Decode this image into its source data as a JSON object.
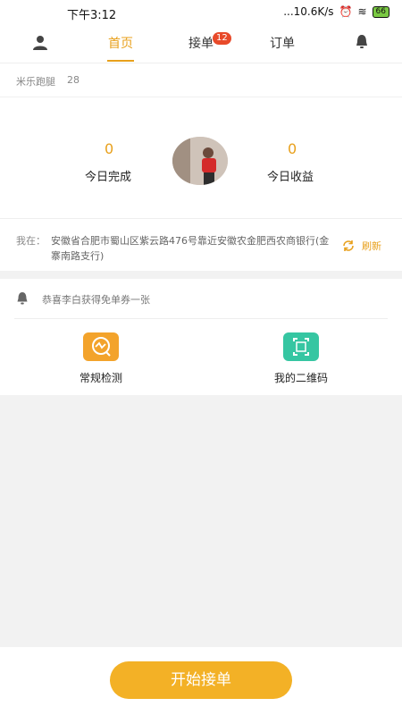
{
  "status": {
    "time": "下午3:12",
    "network": "...10.6K/s",
    "battery": "66"
  },
  "nav": {
    "tabs": [
      "首页",
      "接单",
      "订单"
    ],
    "badge": "12"
  },
  "user": {
    "name": "米乐跑腿",
    "age": "28"
  },
  "stats": {
    "today_done_value": "0",
    "today_done_label": "今日完成",
    "today_income_value": "0",
    "today_income_label": "今日收益"
  },
  "location": {
    "label": "我在：",
    "address": "安徽省合肥市蜀山区紫云路476号靠近安徽农金肥西农商银行(金寨南路支行)",
    "refresh": "刷新"
  },
  "notice": {
    "text": "恭喜李白获得免单券一张"
  },
  "tools": [
    {
      "label": "常规检测",
      "icon": "chat-check-icon",
      "color": "#f3a32b"
    },
    {
      "label": "我的二维码",
      "icon": "qr-frame-icon",
      "color": "#36c6a2"
    }
  ],
  "bottom": {
    "start_label": "开始接单"
  },
  "colors": {
    "accent": "#e8a01c",
    "button": "#f3b126",
    "badge": "#e84a2a"
  }
}
